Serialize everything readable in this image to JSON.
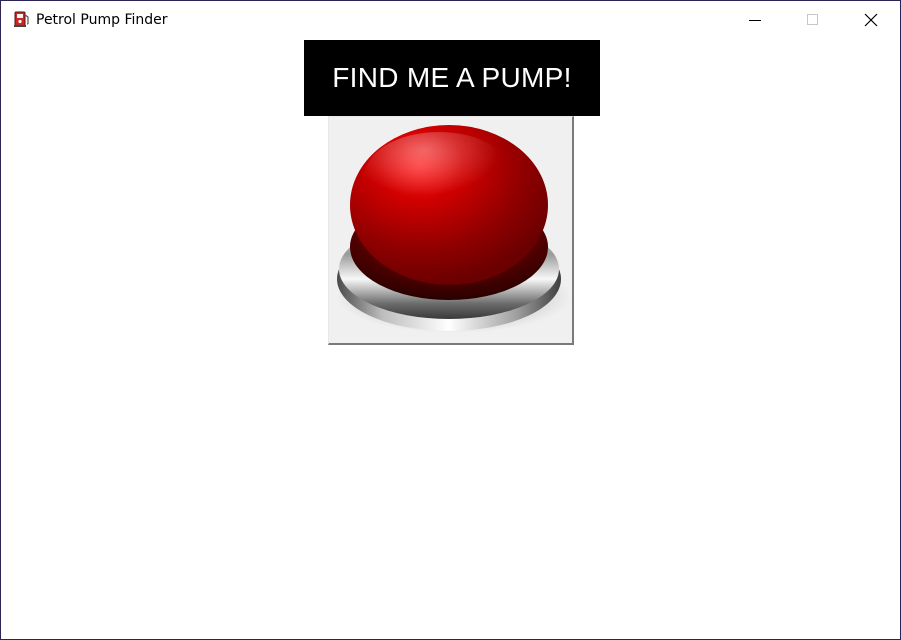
{
  "window": {
    "title": "Petrol Pump Finder",
    "icon": "fuel-pump-icon"
  },
  "controls": {
    "minimize_icon": "minimize-icon",
    "maximize_icon": "maximize-icon",
    "close_icon": "close-icon"
  },
  "main": {
    "banner_text": "FIND ME A PUMP!",
    "button_icon": "big-red-button-icon"
  },
  "colors": {
    "banner_bg": "#000000",
    "banner_text": "#ffffff",
    "button_red": "#c00000",
    "button_face": "#f0f0f0"
  }
}
